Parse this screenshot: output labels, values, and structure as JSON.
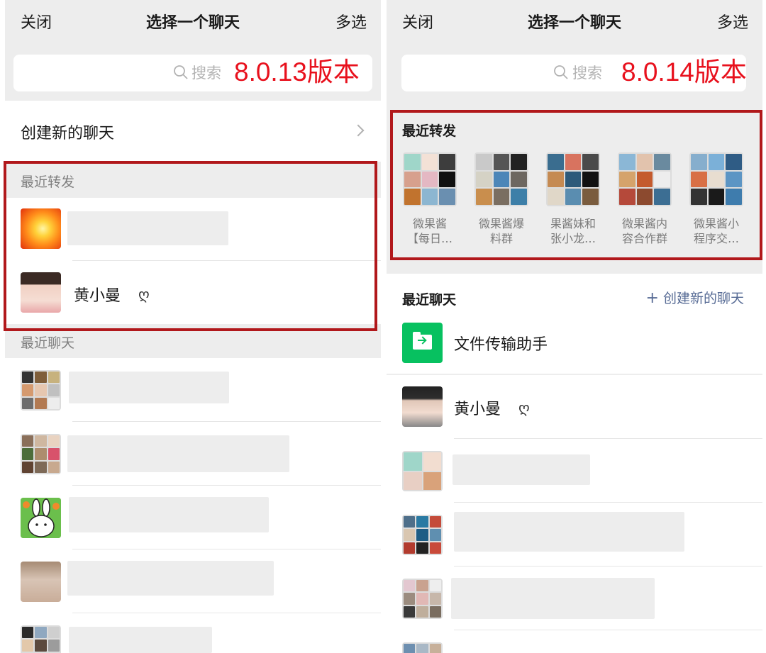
{
  "left": {
    "nav": {
      "close": "关闭",
      "title": "选择一个聊天",
      "multi": "多选"
    },
    "search": {
      "placeholder": "搜索",
      "version": "8.0.13版本"
    },
    "create_chat": "创建新的聊天",
    "recent_forward": {
      "title": "最近转发",
      "contacts": [
        {
          "name": "",
          "avatar_icon": "orange-flower-avatar"
        },
        {
          "name": "黄小曼",
          "badge": "ღ",
          "avatar_icon": "girl-avatar"
        }
      ]
    },
    "recent_chats": {
      "title": "最近聊天",
      "items": [
        {
          "avatar_icon": "group-mosaic-avatar"
        },
        {
          "avatar_icon": "group-mosaic-avatar"
        },
        {
          "avatar_icon": "rabbit-cartoon-avatar"
        },
        {
          "avatar_icon": "girl-photo-avatar"
        },
        {
          "avatar_icon": "group-mosaic-avatar"
        }
      ]
    }
  },
  "right": {
    "nav": {
      "close": "关闭",
      "title": "选择一个聊天",
      "multi": "多选"
    },
    "search": {
      "placeholder": "搜索",
      "version": "8.0.14版本"
    },
    "recent_forward": {
      "title": "最近转发",
      "groups": [
        {
          "line1": "微果酱",
          "line2": "【每日…"
        },
        {
          "line1": "微果酱爆",
          "line2": "料群"
        },
        {
          "line1": "果酱妹和",
          "line2": "张小龙…"
        },
        {
          "line1": "微果酱内",
          "line2": "容合作群"
        },
        {
          "line1": "微果酱小",
          "line2": "程序交…"
        }
      ]
    },
    "recent_chats": {
      "title": "最近聊天",
      "create_link": "创建新的聊天",
      "items": [
        {
          "name": "文件传输助手",
          "avatar_icon": "file-transfer-icon"
        },
        {
          "name": "黄小曼",
          "badge": "ღ",
          "avatar_icon": "girl-avatar"
        },
        {
          "name": "",
          "avatar_icon": "group-mosaic-avatar"
        },
        {
          "name": "",
          "avatar_icon": "group-mosaic-avatar"
        },
        {
          "name": "",
          "avatar_icon": "group-mosaic-avatar"
        }
      ]
    }
  },
  "colors": {
    "highlight_border": "#b1181b",
    "version_text": "#e8111d",
    "link_blue": "#576b95",
    "wechat_green": "#07c160",
    "background_gray": "#ededed"
  }
}
